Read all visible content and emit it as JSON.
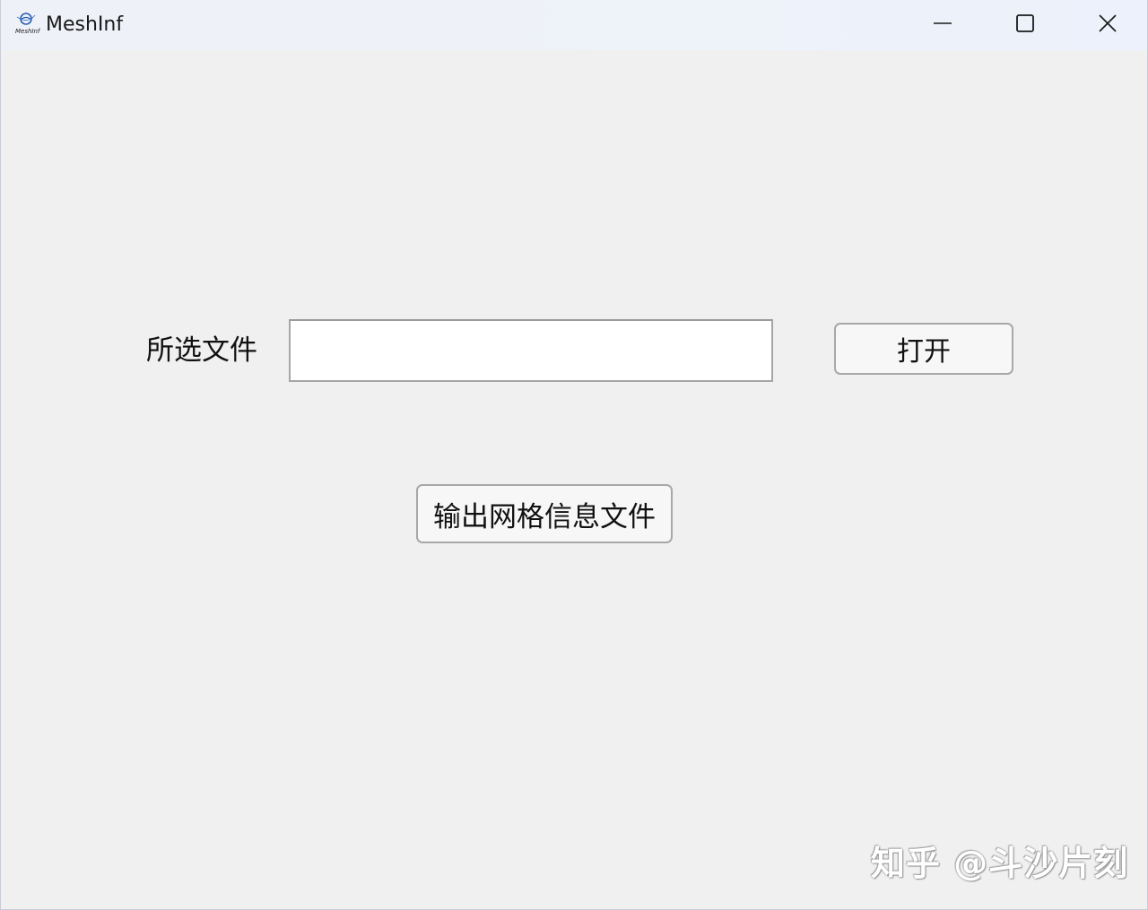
{
  "window": {
    "title": "MeshInf",
    "icon": "meshinf-app-icon",
    "icon_text": "MeshInf",
    "controls": {
      "minimize_icon": "minimize-icon",
      "maximize_icon": "maximize-icon",
      "close_icon": "close-icon"
    }
  },
  "form": {
    "file_label": "所选文件",
    "file_input_value": "",
    "open_button_label": "打开",
    "export_button_label": "输出网格信息文件"
  },
  "watermark": {
    "text": "知乎 @斗沙片刻"
  },
  "colors": {
    "background": "#f0f0f0",
    "titlebar": "#eef1f7",
    "input_border": "#a6a6a6",
    "button_face": "#f7f7f7"
  }
}
